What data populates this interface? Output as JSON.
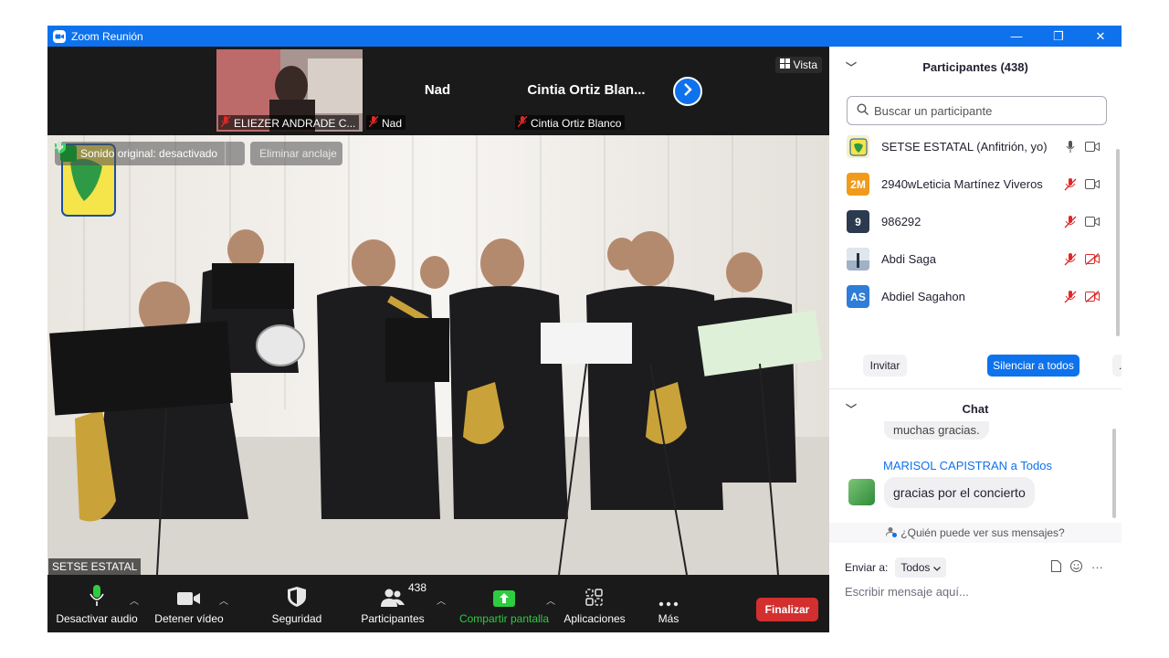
{
  "window": {
    "title": "Zoom Reunión",
    "minimize": "—",
    "restore": "❐",
    "close": "✕"
  },
  "strip": {
    "thumbnails": [
      {
        "name": "ELIEZER ANDRADE C...",
        "has_video": true
      },
      {
        "name": "Nad",
        "center": "Nad",
        "has_video": false
      },
      {
        "name": "Cintia Ortiz Blanco",
        "center": "Cintia  Ortiz  Blan...",
        "has_video": false
      }
    ],
    "view_label": "Vista"
  },
  "video": {
    "original_sound": "Sonido original: desactivado",
    "unpin": "Eliminar anclaje",
    "speaker_name": "SETSE ESTATAL"
  },
  "toolbar": {
    "mute": "Desactivar audio",
    "stop_video": "Detener vídeo",
    "security": "Seguridad",
    "participants": "Participantes",
    "participants_count": "438",
    "share": "Compartir pantalla",
    "apps": "Aplicaciones",
    "more": "Más",
    "end": "Finalizar"
  },
  "participants_panel": {
    "title": "Participantes (438)",
    "search_placeholder": "Buscar un participante",
    "list": [
      {
        "name": "SETSE ESTATAL (Anfitrión, yo)",
        "avatar": "",
        "avatar_color": "#f5f0c8",
        "mic": "on",
        "cam": "on"
      },
      {
        "name": "2940wLeticia Martínez Viveros",
        "avatar": "2M",
        "avatar_color": "#f19a1b",
        "mic": "off",
        "cam": "on"
      },
      {
        "name": "986292",
        "avatar": "9",
        "avatar_color": "#2b3a4f",
        "mic": "off",
        "cam": "on"
      },
      {
        "name": "Abdi Saga",
        "avatar": "",
        "avatar_color": "#6a8fb5",
        "mic": "off",
        "cam": "off"
      },
      {
        "name": "Abdiel Sagahon",
        "avatar": "AS",
        "avatar_color": "#2f7dd6",
        "mic": "off",
        "cam": "off"
      }
    ],
    "invite": "Invitar",
    "mute_all": "Silenciar a todos",
    "more": "..."
  },
  "chat_panel": {
    "title": "Chat",
    "prev_message": "muchas gracias.",
    "sender": "MARISOL CAPISTRAN a Todos",
    "message": "gracias por el concierto",
    "who_can_see": "¿Quién puede ver sus mensajes?",
    "send_to_label": "Enviar a:",
    "send_to_value": "Todos",
    "input_placeholder": "Escribir mensaje aquí...",
    "more": "···"
  },
  "colors": {
    "zoom_blue": "#0e72ed",
    "end_red": "#d32f2f",
    "share_green": "#2ecc40",
    "mute_red": "#e02828"
  }
}
